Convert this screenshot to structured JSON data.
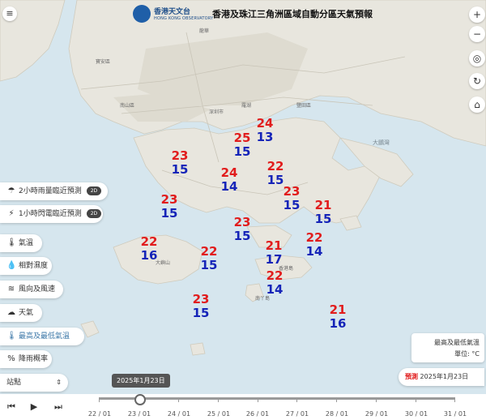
{
  "header": {
    "logo_cn": "香港天文台",
    "logo_en": "HONG KONG OBSERVATORY",
    "title": "香港及珠江三角洲區域自動分區天氣預報"
  },
  "right_buttons": [
    {
      "icon": "plus-icon",
      "glyph": "+"
    },
    {
      "icon": "minus-icon",
      "glyph": "−"
    },
    {
      "icon": "locate-icon",
      "glyph": "◎"
    },
    {
      "icon": "refresh-icon",
      "glyph": "↻"
    },
    {
      "icon": "home-icon",
      "glyph": "⌂"
    }
  ],
  "side_menu": {
    "nowcast_rain": "2小時雨量臨近預測",
    "nowcast_lightning": "1小時閃電臨近預測",
    "toggle_label": "2D",
    "temperature": "氣溫",
    "humidity": "相對濕度",
    "wind": "風向及風速",
    "weather": "天氣",
    "max_min_temp": "最高及最低氣溫",
    "rain_prob": "降雨概率"
  },
  "station_select": "站點",
  "legend": {
    "title": "最高及最低氣溫",
    "unit": "單位: °C"
  },
  "forecast": {
    "label": "預測",
    "date": "2025年1月23日"
  },
  "timeline": {
    "tooltip": "2025年1月23日",
    "labels": [
      "22 / 01",
      "23 / 01",
      "24 / 01",
      "25 / 01",
      "26 / 01",
      "27 / 01",
      "28 / 01",
      "29 / 01",
      "30 / 01",
      "31 / 01"
    ]
  },
  "map_labels": {
    "pearl_river": "珠江",
    "dapeng": "大鵬灣",
    "shenzhen": "深圳市",
    "nanshan": "南山區",
    "bao_an": "寶安區",
    "longhua": "龍華",
    "luohu": "羅湖",
    "yantian": "鹽田區",
    "lantau": "大嶼山",
    "lamma": "南丫島",
    "hk_island": "香港島"
  },
  "temperatures": [
    {
      "hi": "24",
      "lo": "13"
    },
    {
      "hi": "25",
      "lo": "15"
    },
    {
      "hi": "23",
      "lo": "15"
    },
    {
      "hi": "22",
      "lo": "15"
    },
    {
      "hi": "24",
      "lo": "14"
    },
    {
      "hi": "23",
      "lo": "15"
    },
    {
      "hi": "21",
      "lo": "15"
    },
    {
      "hi": "23",
      "lo": "15"
    },
    {
      "hi": "23",
      "lo": "15"
    },
    {
      "hi": "22",
      "lo": "14"
    },
    {
      "hi": "22",
      "lo": "16"
    },
    {
      "hi": "22",
      "lo": "15"
    },
    {
      "hi": "21",
      "lo": "17"
    },
    {
      "hi": "22",
      "lo": "14"
    },
    {
      "hi": "23",
      "lo": "15"
    },
    {
      "hi": "21",
      "lo": "16"
    }
  ],
  "colors": {
    "max_temp": "#e11c1c",
    "min_temp": "#1524b8",
    "accent": "#3d78a8",
    "sea": "#d6e6ee",
    "land": "#e8e6de"
  }
}
